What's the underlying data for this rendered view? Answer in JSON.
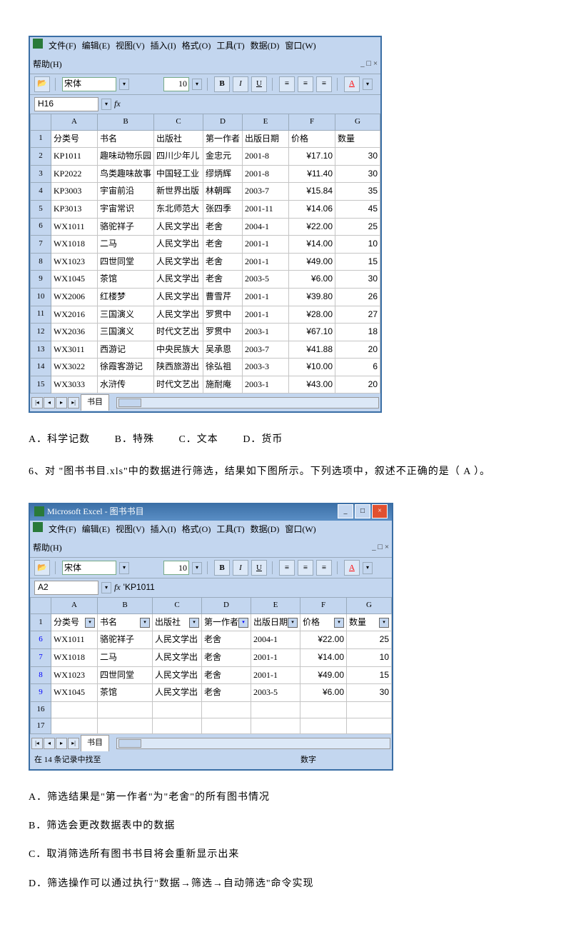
{
  "q5_options": {
    "a": "A．科学记数",
    "b": "B．特殊",
    "c": "C．文本",
    "d": "D．货币"
  },
  "q6_text": "6、对 \"图书书目.xls\"中的数据进行筛选，结果如下图所示。下列选项中，叙述不正确的是（    A  ）。",
  "q6_options": {
    "a": "A．筛选结果是\"第一作者\"为\"老舍\"的所有图书情况",
    "b": "B．筛选会更改数据表中的数据",
    "c": "C．取消筛选所有图书书目将会重新显示出来",
    "d": "D．筛选操作可以通过执行\"数据→筛选→自动筛选\"命令实现"
  },
  "excel1": {
    "menus": {
      "file": "文件(F)",
      "edit": "编辑(E)",
      "view": "视图(V)",
      "insert": "插入(I)",
      "format": "格式(O)",
      "tools": "工具(T)",
      "data": "数据(D)",
      "window": "窗口(W)",
      "help": "帮助(H)"
    },
    "font": "宋体",
    "size": "10",
    "cell": "H16",
    "formula": "",
    "cols": [
      "A",
      "B",
      "C",
      "D",
      "E",
      "F",
      "G"
    ],
    "headers": [
      "分类号",
      "书名",
      "出版社",
      "第一作者",
      "出版日期",
      "价格",
      "数量"
    ],
    "rows": [
      [
        "2",
        "KP1011",
        "趣味动物乐园",
        "四川少年儿",
        "金忠元",
        "2001-8",
        "¥17.10",
        "30"
      ],
      [
        "3",
        "KP2022",
        "鸟类趣味故事",
        "中国轻工业",
        "缪炳辉",
        "2001-8",
        "¥11.40",
        "30"
      ],
      [
        "4",
        "KP3003",
        "宇宙前沿",
        "新世界出版",
        "林朝晖",
        "2003-7",
        "¥15.84",
        "35"
      ],
      [
        "5",
        "KP3013",
        "宇宙常识",
        "东北师范大",
        "张四季",
        "2001-11",
        "¥14.06",
        "45"
      ],
      [
        "6",
        "WX1011",
        "骆驼祥子",
        "人民文学出",
        "老舍",
        "2004-1",
        "¥22.00",
        "25"
      ],
      [
        "7",
        "WX1018",
        "二马",
        "人民文学出",
        "老舍",
        "2001-1",
        "¥14.00",
        "10"
      ],
      [
        "8",
        "WX1023",
        "四世同堂",
        "人民文学出",
        "老舍",
        "2001-1",
        "¥49.00",
        "15"
      ],
      [
        "9",
        "WX1045",
        "茶馆",
        "人民文学出",
        "老舍",
        "2003-5",
        "¥6.00",
        "30"
      ],
      [
        "10",
        "WX2006",
        "红楼梦",
        "人民文学出",
        "曹雪芹",
        "2001-1",
        "¥39.80",
        "26"
      ],
      [
        "11",
        "WX2016",
        "三国演义",
        "人民文学出",
        "罗贯中",
        "2001-1",
        "¥28.00",
        "27"
      ],
      [
        "12",
        "WX2036",
        "三国演义",
        "时代文艺出",
        "罗贯中",
        "2003-1",
        "¥67.10",
        "18"
      ],
      [
        "13",
        "WX3011",
        "西游记",
        "中央民族大",
        "吴承恩",
        "2003-7",
        "¥41.88",
        "20"
      ],
      [
        "14",
        "WX3022",
        "徐霞客游记",
        "陕西旅游出",
        "徐弘祖",
        "2003-3",
        "¥10.00",
        "6"
      ],
      [
        "15",
        "WX3033",
        "水浒传",
        "时代文艺出",
        "施耐庵",
        "2003-1",
        "¥43.00",
        "20"
      ]
    ],
    "sheet": "书目"
  },
  "excel2": {
    "title": "Microsoft Excel - 图书书目",
    "menus": {
      "file": "文件(F)",
      "edit": "编辑(E)",
      "view": "视图(V)",
      "insert": "插入(I)",
      "format": "格式(O)",
      "tools": "工具(T)",
      "data": "数据(D)",
      "window": "窗口(W)",
      "help": "帮助(H)"
    },
    "font": "宋体",
    "size": "10",
    "cell": "A2",
    "formula": "'KP1011",
    "cols": [
      "A",
      "B",
      "C",
      "D",
      "E",
      "F",
      "G"
    ],
    "headers": [
      "分类号",
      "书名",
      "出版社",
      "第一作者",
      "出版日期",
      "价格",
      "数量"
    ],
    "rows": [
      [
        "6",
        "WX1011",
        "骆驼祥子",
        "人民文学出",
        "老舍",
        "2004-1",
        "¥22.00",
        "25"
      ],
      [
        "7",
        "WX1018",
        "二马",
        "人民文学出",
        "老舍",
        "2001-1",
        "¥14.00",
        "10"
      ],
      [
        "8",
        "WX1023",
        "四世同堂",
        "人民文学出",
        "老舍",
        "2001-1",
        "¥49.00",
        "15"
      ],
      [
        "9",
        "WX1045",
        "茶馆",
        "人民文学出",
        "老舍",
        "2003-5",
        "¥6.00",
        "30"
      ]
    ],
    "extra_rows": [
      "16",
      "17"
    ],
    "sheet": "书目",
    "status_left": "在 14 条记录中找至",
    "status_right": "数字"
  },
  "chart_data": {
    "type": "table",
    "note": "Two Excel spreadsheet screenshots; data captured in excel1.rows and excel2.rows"
  }
}
